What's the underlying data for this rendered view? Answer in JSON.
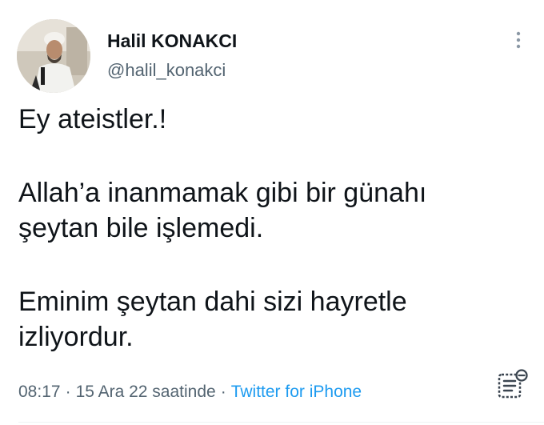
{
  "author": {
    "display_name": "Halil KONAKCI",
    "handle": "@halil_konakci",
    "avatar_icon": "profile-photo"
  },
  "tweet": {
    "lines": [
      "Ey ateistler.!",
      "",
      "Allah’a inanmamak gibi bir günahı",
      "şeytan bile işlemedi.",
      "",
      "Eminim şeytan dahi sizi hayretle",
      "izliyordur."
    ]
  },
  "meta": {
    "time": "08:17",
    "date": "15 Ara 22 saatinde",
    "separator": "·",
    "source": "Twitter for iPhone"
  },
  "icons": {
    "more": "vertical-ellipsis-icon",
    "analytics": "view-tweet-analytics-icon"
  },
  "colors": {
    "text": "#0f1419",
    "secondary": "#536471",
    "link": "#1d9bf0"
  }
}
